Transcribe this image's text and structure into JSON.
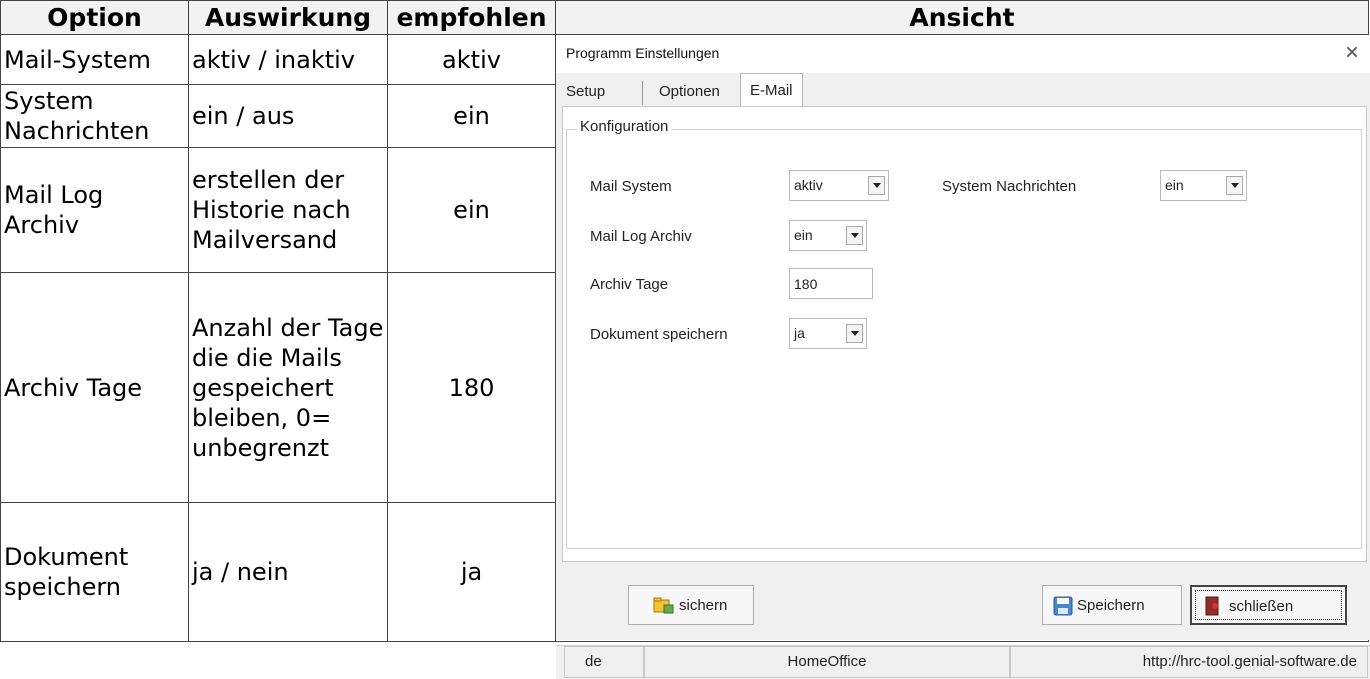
{
  "table": {
    "headers": {
      "option": "Option",
      "auswirkung": "Auswirkung",
      "empfohlen": "empfohlen",
      "ansicht": "Ansicht"
    },
    "rows": [
      {
        "option": "Mail-System",
        "auswirkung": "aktiv / inaktiv",
        "empfohlen": "aktiv"
      },
      {
        "option": "System Nachrichten",
        "auswirkung": "ein / aus",
        "empfohlen": "ein"
      },
      {
        "option": "Mail Log Archiv",
        "auswirkung": "erstellen der Historie nach Mailversand",
        "empfohlen": "ein"
      },
      {
        "option": "Archiv Tage",
        "auswirkung": "Anzahl der Tage die die Mails gespeichert bleiben, 0= unbegrenzt",
        "empfohlen": "180"
      },
      {
        "option": "Dokument speichern",
        "auswirkung": "ja / nein",
        "empfohlen": "ja"
      }
    ]
  },
  "dialog": {
    "title": "Programm Einstellungen",
    "close_glyph": "×",
    "tabs": [
      "Setup",
      "Optionen",
      "E-Mail"
    ],
    "active_tab": "E-Mail",
    "group_label": "Konfiguration",
    "fields": {
      "mail_system": {
        "label": "Mail System",
        "value": "aktiv"
      },
      "system_nachrichten": {
        "label": "System Nachrichten",
        "value": "ein"
      },
      "mail_log_archiv": {
        "label": "Mail Log Archiv",
        "value": "ein"
      },
      "archiv_tage": {
        "label": "Archiv Tage",
        "value": "180"
      },
      "dokument_speichern": {
        "label": "Dokument speichern",
        "value": "ja"
      }
    },
    "buttons": {
      "sichern": "sichern",
      "speichern": "Speichern",
      "schliessen": "schließen"
    },
    "icons": {
      "sichern": "backup-folder-icon",
      "speichern": "floppy-disk-icon",
      "schliessen": "exit-door-icon"
    },
    "status": {
      "language": "de",
      "workspace": "HomeOffice",
      "url": "http://hrc-tool.genial-software.de"
    }
  },
  "colors": {
    "header_bg": "#f2f2f2",
    "dialog_bg": "#f0f0f0",
    "panel_bg": "#ffffff"
  }
}
